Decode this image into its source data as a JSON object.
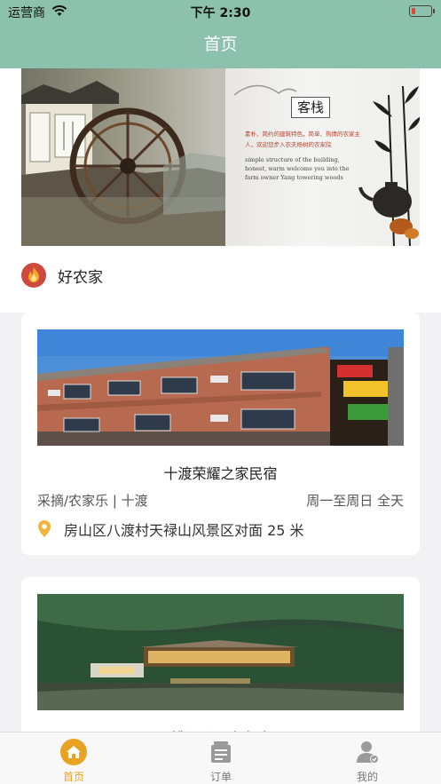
{
  "status_bar": {
    "carrier": "运营商",
    "time": "下午 2:30"
  },
  "nav": {
    "title": "首页"
  },
  "banner": {
    "badge": "客栈",
    "cn_text": "素朴、简约的建筑特色，简单、热情的农家主人，欢迎您步入农夫杨树的农家院",
    "en_text": "simple structure of the building, honest, warm welcome you into the farm owner Yang towering woods"
  },
  "section": {
    "title": "好农家"
  },
  "listings": [
    {
      "name": "十渡荣耀之家民宿",
      "tags": "采摘/农家乐 | 十渡",
      "hours": "周一至周日 全天",
      "address": "房山区八渡村天禄山风景区对面 25 米"
    },
    {
      "name": "桃源谷 · 农家院",
      "tags": "",
      "hours": "",
      "address": ""
    }
  ],
  "tabs": [
    {
      "label": "首页",
      "icon": "home-icon",
      "active": true
    },
    {
      "label": "订单",
      "icon": "order-icon",
      "active": false
    },
    {
      "label": "我的",
      "icon": "profile-icon",
      "active": false
    }
  ],
  "colors": {
    "header": "#8cc2ad",
    "accent": "#e9a323",
    "location_pin": "#f0b43a",
    "section_icon": "#cf4a3e"
  }
}
